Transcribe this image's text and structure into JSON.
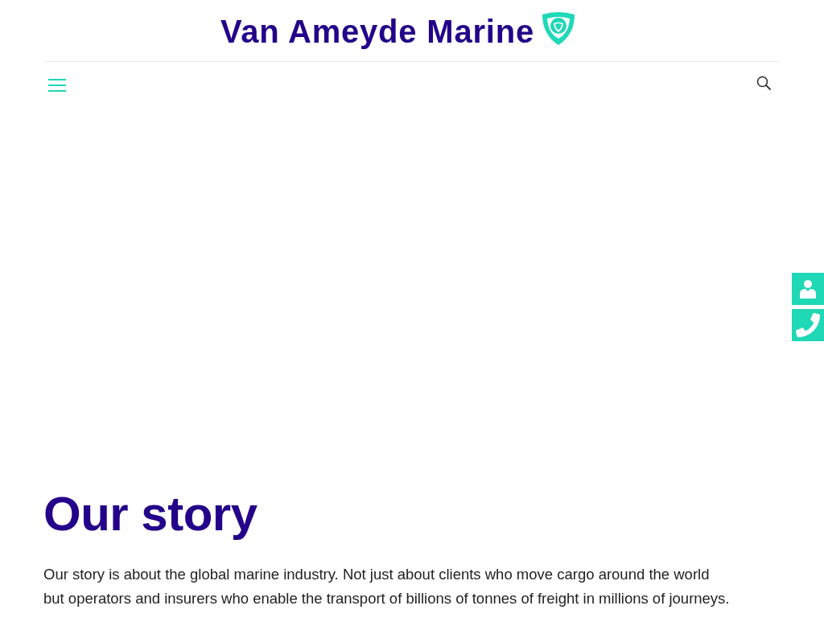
{
  "header": {
    "logo_text": "Van Ameyde Marine"
  },
  "story": {
    "heading": "Our story",
    "paragraph_lines": [
      "Our story is about the global marine industry. Not just about clients who move cargo around the world",
      "but operators and insurers who enable the transport of billions of tonnes of freight in millions of journeys."
    ]
  }
}
